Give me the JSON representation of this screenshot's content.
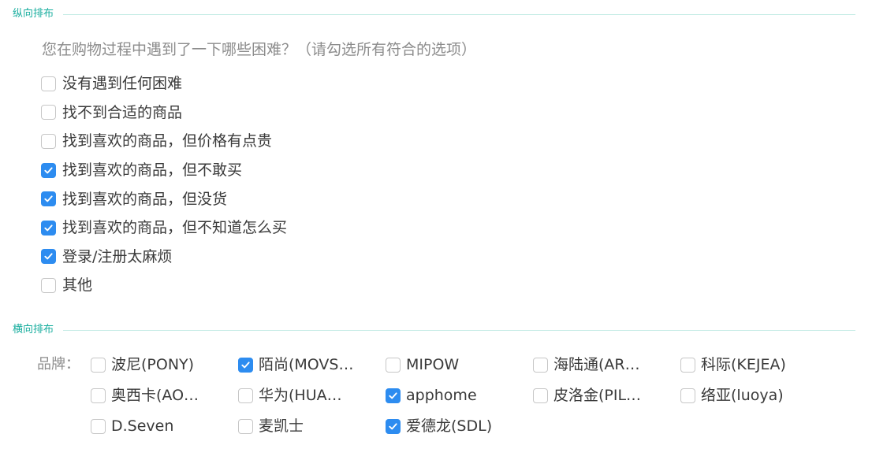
{
  "sections": {
    "vertical_title": "纵向排布",
    "horizontal_title": "横向排布"
  },
  "question": "您在购物过程中遇到了一下哪些困难？（请勾选所有符合的选项）",
  "vertical_options": [
    {
      "label": "没有遇到任何困难",
      "checked": false
    },
    {
      "label": "找不到合适的商品",
      "checked": false
    },
    {
      "label": "找到喜欢的商品，但价格有点贵",
      "checked": false
    },
    {
      "label": "找到喜欢的商品，但不敢买",
      "checked": true
    },
    {
      "label": "找到喜欢的商品，但没货",
      "checked": true
    },
    {
      "label": "找到喜欢的商品，但不知道怎么买",
      "checked": true
    },
    {
      "label": "登录/注册太麻烦",
      "checked": true
    },
    {
      "label": "其他",
      "checked": false
    }
  ],
  "brand_label": "品牌：",
  "brand_options": [
    {
      "label": "波尼(PONY)",
      "checked": false
    },
    {
      "label": "陌尚(MOVS…",
      "checked": true
    },
    {
      "label": "MIPOW",
      "checked": false
    },
    {
      "label": "海陆通(AR…",
      "checked": false
    },
    {
      "label": "科际(KEJEA)",
      "checked": false
    },
    {
      "label": "奥西卡(AO…",
      "checked": false
    },
    {
      "label": "华为(HUA…",
      "checked": false
    },
    {
      "label": "apphome",
      "checked": true
    },
    {
      "label": "皮洛金(PIL…",
      "checked": false
    },
    {
      "label": "络亚(luoya)",
      "checked": false
    },
    {
      "label": "D.Seven",
      "checked": false
    },
    {
      "label": "麦凯士",
      "checked": false
    },
    {
      "label": "爱德龙(SDL)",
      "checked": true
    }
  ],
  "colors": {
    "accent": "#2d8cf0",
    "section_title": "#1aae9f",
    "divider": "#c6ece6"
  }
}
